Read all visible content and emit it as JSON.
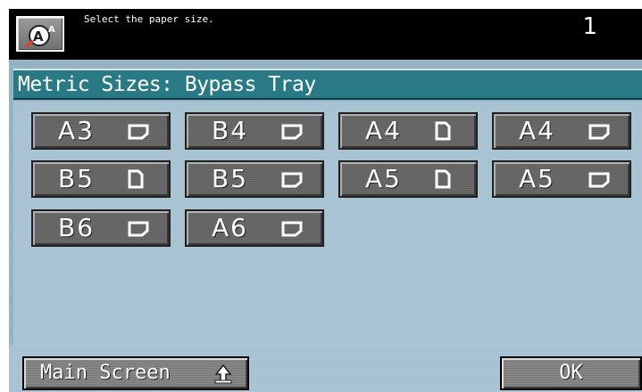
{
  "header": {
    "message": "Select the paper size.",
    "counter": "1",
    "help_icon": "help-guide-icon"
  },
  "panel": {
    "title": "Metric Sizes: Bypass Tray"
  },
  "sizes": [
    {
      "label": "A3",
      "orientation": "landscape"
    },
    {
      "label": "B4",
      "orientation": "landscape"
    },
    {
      "label": "A4",
      "orientation": "portrait"
    },
    {
      "label": "A4",
      "orientation": "landscape"
    },
    {
      "label": "B5",
      "orientation": "portrait"
    },
    {
      "label": "B5",
      "orientation": "landscape"
    },
    {
      "label": "A5",
      "orientation": "portrait"
    },
    {
      "label": "A5",
      "orientation": "landscape"
    },
    {
      "label": "B6",
      "orientation": "landscape"
    },
    {
      "label": "A6",
      "orientation": "landscape"
    }
  ],
  "footer": {
    "main_screen_label": "Main Screen",
    "ok_label": "OK"
  },
  "colors": {
    "title_bar": "#2a7a86",
    "panel_bg": "#a3bfd0",
    "button_gray": "#6e6e6e"
  }
}
